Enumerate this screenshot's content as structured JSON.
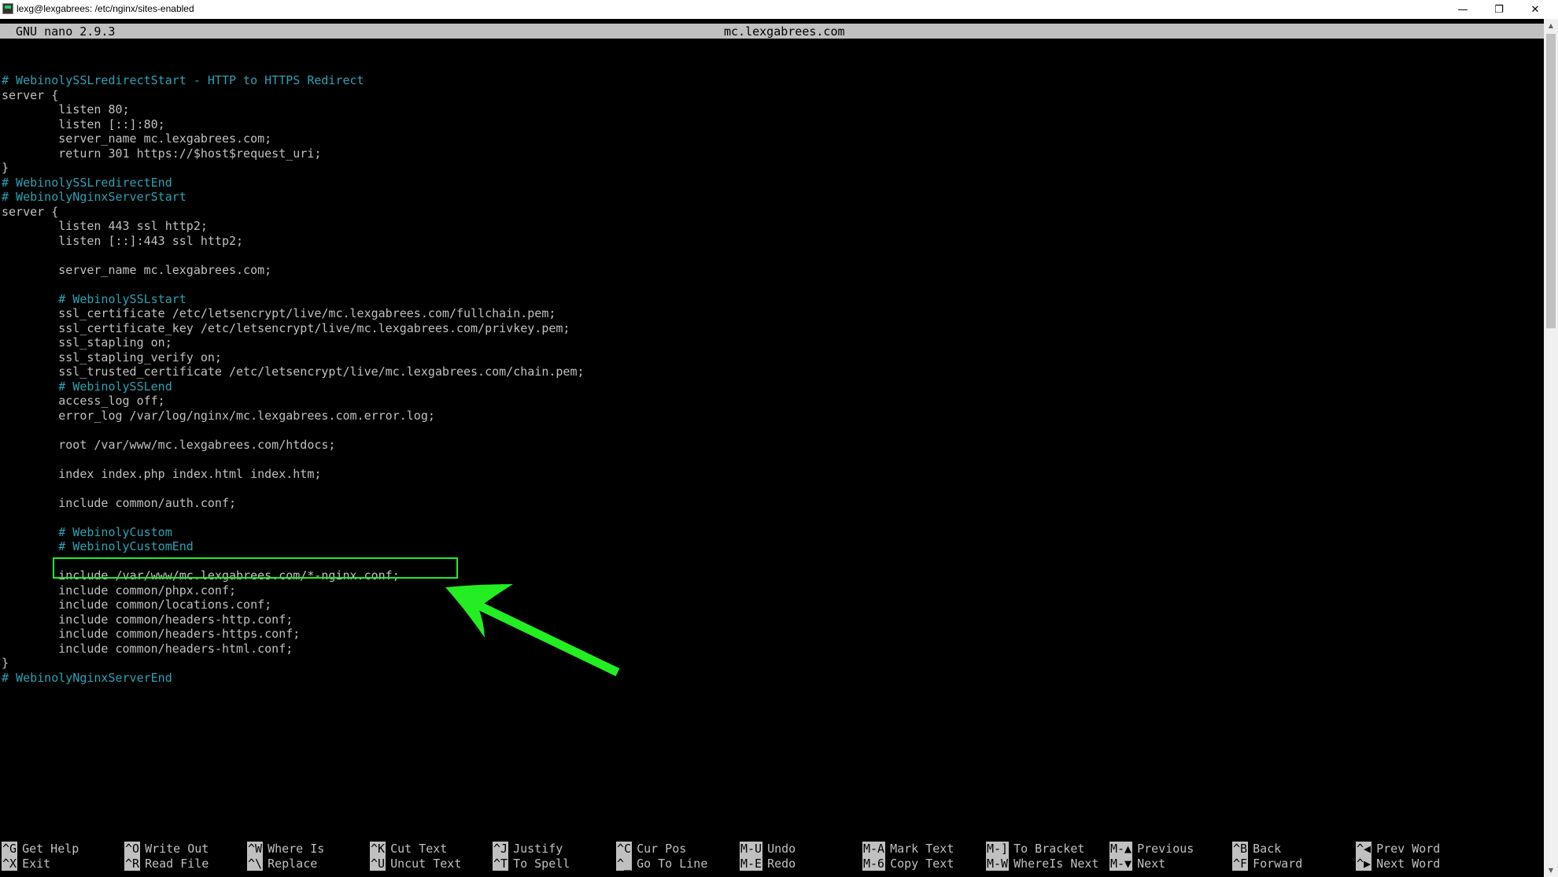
{
  "window": {
    "title": "lexg@lexgabrees: /etc/nginx/sites-enabled",
    "min_glyph": "—",
    "max_glyph": "❐",
    "close_glyph": "✕"
  },
  "nano": {
    "version": "GNU nano 2.9.3",
    "filename": "mc.lexgabrees.com"
  },
  "editor": {
    "lines": [
      {
        "text": "",
        "type": "code"
      },
      {
        "text": "",
        "type": "code"
      },
      {
        "text": "# WebinolySSLredirectStart - HTTP to HTTPS Redirect",
        "type": "comment"
      },
      {
        "text": "server {",
        "type": "code"
      },
      {
        "text": "        listen 80;",
        "type": "code"
      },
      {
        "text": "        listen [::]:80;",
        "type": "code"
      },
      {
        "text": "        server_name mc.lexgabrees.com;",
        "type": "code"
      },
      {
        "text": "        return 301 https://$host$request_uri;",
        "type": "code"
      },
      {
        "text": "}",
        "type": "code"
      },
      {
        "text": "# WebinolySSLredirectEnd",
        "type": "comment"
      },
      {
        "text": "# WebinolyNginxServerStart",
        "type": "comment"
      },
      {
        "text": "server {",
        "type": "code"
      },
      {
        "text": "        listen 443 ssl http2;",
        "type": "code"
      },
      {
        "text": "        listen [::]:443 ssl http2;",
        "type": "code"
      },
      {
        "text": "",
        "type": "code"
      },
      {
        "text": "        server_name mc.lexgabrees.com;",
        "type": "code"
      },
      {
        "text": "",
        "type": "code"
      },
      {
        "text": "        # WebinolySSLstart",
        "type": "comment"
      },
      {
        "text": "        ssl_certificate /etc/letsencrypt/live/mc.lexgabrees.com/fullchain.pem;",
        "type": "code"
      },
      {
        "text": "        ssl_certificate_key /etc/letsencrypt/live/mc.lexgabrees.com/privkey.pem;",
        "type": "code"
      },
      {
        "text": "        ssl_stapling on;",
        "type": "code"
      },
      {
        "text": "        ssl_stapling_verify on;",
        "type": "code"
      },
      {
        "text": "        ssl_trusted_certificate /etc/letsencrypt/live/mc.lexgabrees.com/chain.pem;",
        "type": "code"
      },
      {
        "text": "        # WebinolySSLend",
        "type": "comment"
      },
      {
        "text": "        access_log off;",
        "type": "code"
      },
      {
        "text": "        error_log /var/log/nginx/mc.lexgabrees.com.error.log;",
        "type": "code"
      },
      {
        "text": "",
        "type": "code"
      },
      {
        "text": "        root /var/www/mc.lexgabrees.com/htdocs;",
        "type": "code"
      },
      {
        "text": "",
        "type": "code"
      },
      {
        "text": "        index index.php index.html index.htm;",
        "type": "code"
      },
      {
        "text": "",
        "type": "code"
      },
      {
        "text": "        include common/auth.conf;",
        "type": "code"
      },
      {
        "text": "",
        "type": "code"
      },
      {
        "text": "        # WebinolyCustom",
        "type": "comment"
      },
      {
        "text": "        # WebinolyCustomEnd",
        "type": "comment"
      },
      {
        "text": "",
        "type": "code"
      },
      {
        "text": "        include /var/www/mc.lexgabrees.com/*-nginx.conf;",
        "type": "code"
      },
      {
        "text": "        include common/phpx.conf;",
        "type": "code"
      },
      {
        "text": "        include common/locations.conf;",
        "type": "code"
      },
      {
        "text": "        include common/headers-http.conf;",
        "type": "code"
      },
      {
        "text": "        include common/headers-https.conf;",
        "type": "code"
      },
      {
        "text": "        include common/headers-html.conf;",
        "type": "code"
      },
      {
        "text": "}",
        "type": "code"
      },
      {
        "text": "# WebinolyNginxServerEnd",
        "type": "comment"
      }
    ]
  },
  "annotation": {
    "color": "#22ee22",
    "box_icon": "highlight-box",
    "arrow_icon": "arrow-pointer-icon"
  },
  "shortcuts": {
    "top": [
      {
        "key": "^G",
        "label": "Get Help"
      },
      {
        "key": "^O",
        "label": "Write Out"
      },
      {
        "key": "^W",
        "label": "Where Is"
      },
      {
        "key": "^K",
        "label": "Cut Text"
      },
      {
        "key": "^J",
        "label": "Justify"
      },
      {
        "key": "^C",
        "label": "Cur Pos"
      },
      {
        "key": "M-U",
        "label": "Undo"
      },
      {
        "key": "M-A",
        "label": "Mark Text"
      },
      {
        "key": "M-]",
        "label": "To Bracket"
      },
      {
        "key": "M-▲",
        "label": "Previous"
      },
      {
        "key": "^B",
        "label": "Back"
      },
      {
        "key": "^◀",
        "label": "Prev Word"
      }
    ],
    "bottom": [
      {
        "key": "^X",
        "label": "Exit"
      },
      {
        "key": "^R",
        "label": "Read File"
      },
      {
        "key": "^\\",
        "label": "Replace"
      },
      {
        "key": "^U",
        "label": "Uncut Text"
      },
      {
        "key": "^T",
        "label": "To Spell"
      },
      {
        "key": "^_",
        "label": "Go To Line"
      },
      {
        "key": "M-E",
        "label": "Redo"
      },
      {
        "key": "M-6",
        "label": "Copy Text"
      },
      {
        "key": "M-W",
        "label": "WhereIs Next"
      },
      {
        "key": "M-▼",
        "label": "Next"
      },
      {
        "key": "^F",
        "label": "Forward"
      },
      {
        "key": "^▶",
        "label": "Next Word"
      }
    ]
  },
  "scrollbar": {
    "up_glyph": "▲",
    "down_glyph": "▼"
  }
}
